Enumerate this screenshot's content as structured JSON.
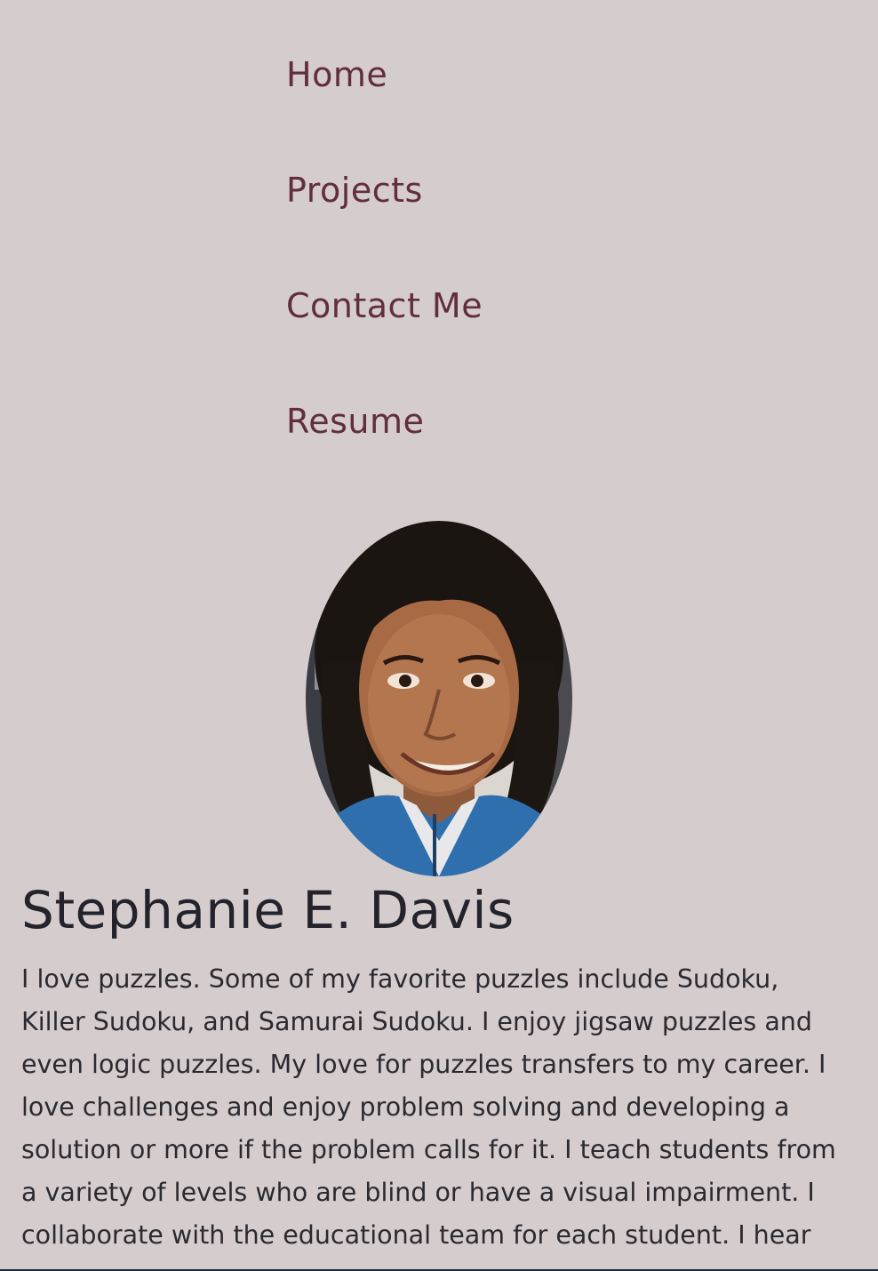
{
  "nav": {
    "items": [
      {
        "label": "Home"
      },
      {
        "label": "Projects"
      },
      {
        "label": "Contact Me"
      },
      {
        "label": "Resume"
      }
    ]
  },
  "profile": {
    "name": "Stephanie E. Davis",
    "bio_lines": [
      "I love puzzles. Some of my favorite puzzles include Sudoku,",
      "Killer Sudoku, and Samurai Sudoku. I enjoy jigsaw puzzles and",
      "even logic puzzles. My love for puzzles transfers to my career. I",
      "love challenges and enjoy problem solving and developing a",
      "solution or more if the problem calls for it. I teach students from",
      "a variety of levels who are blind or have a visual impairment. I",
      "collaborate with the educational team for each student. I hear"
    ]
  },
  "colors": {
    "background": "#d5cccd",
    "nav_link": "#612e3e",
    "text": "#2a2a30"
  }
}
